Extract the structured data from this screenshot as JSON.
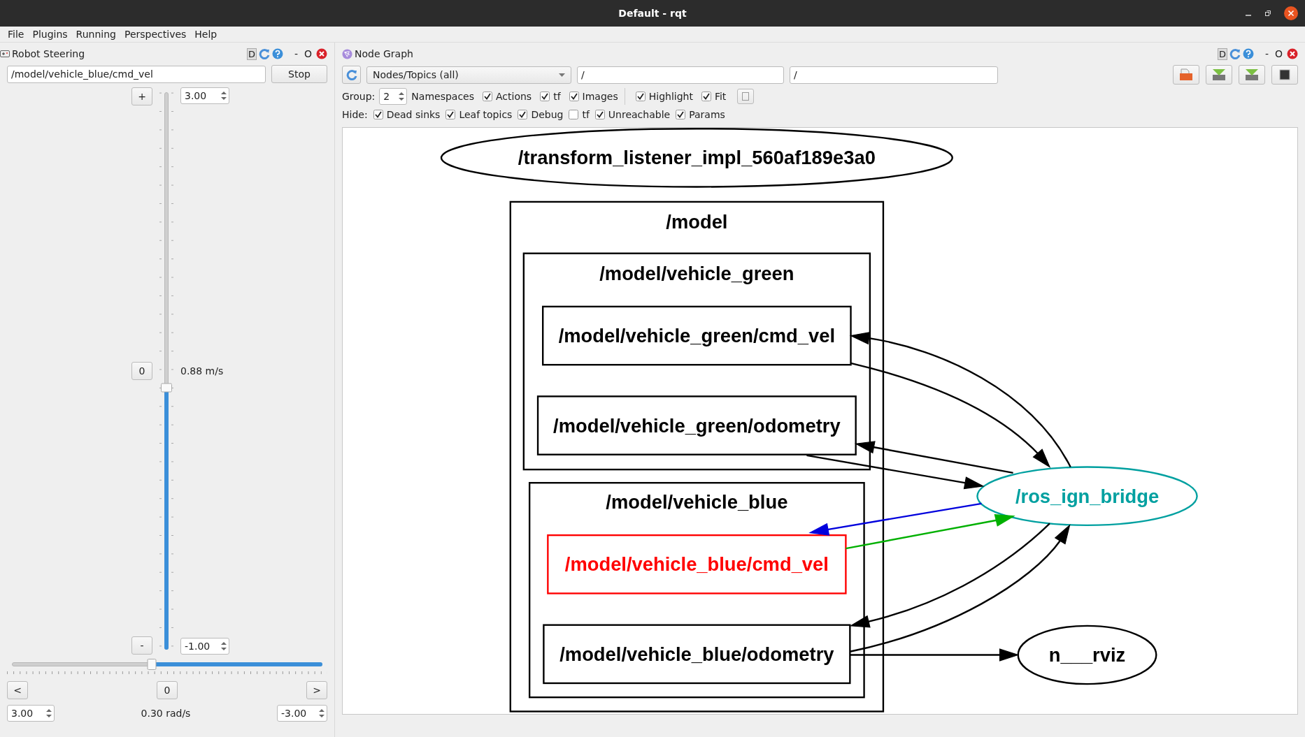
{
  "window": {
    "title": "Default - rqt"
  },
  "menu": [
    "File",
    "Plugins",
    "Running",
    "Perspectives",
    "Help"
  ],
  "robot_steering": {
    "title": "Robot Steering",
    "dock_buttons": [
      "D",
      "-",
      "O"
    ],
    "topic": "/model/vehicle_blue/cmd_vel",
    "stop_button": "Stop",
    "linear": {
      "increase": "+",
      "reset": "0",
      "decrease": "-",
      "max": "3.00",
      "min": "-1.00",
      "reading": "0.88 m/s",
      "level": 0.47
    },
    "angular": {
      "left": "<",
      "reset": "0",
      "right": ">",
      "max": "3.00",
      "min": "-3.00",
      "reading": "0.30 rad/s",
      "level": 0.55
    }
  },
  "node_graph": {
    "title": "Node Graph",
    "dock_buttons": [
      "D",
      "-",
      "O"
    ],
    "mode": "Nodes/Topics (all)",
    "node_filter": "/",
    "topic_filter": "/",
    "group_label": "Group:",
    "group": "2",
    "namespaces_label": "Namespaces",
    "options": [
      {
        "label": "Actions",
        "checked": true
      },
      {
        "label": "tf",
        "checked": true
      },
      {
        "label": "Images",
        "checked": true
      },
      {
        "label": "Highlight",
        "checked": true
      },
      {
        "label": "Fit",
        "checked": true
      }
    ],
    "hide_label": "Hide:",
    "hide": [
      {
        "label": "Dead sinks",
        "checked": true
      },
      {
        "label": "Leaf topics",
        "checked": true
      },
      {
        "label": "Debug",
        "checked": true
      },
      {
        "label": "tf",
        "checked": false
      },
      {
        "label": "Unreachable",
        "checked": true
      },
      {
        "label": "Params",
        "checked": true
      }
    ],
    "graph": {
      "nodes": [
        {
          "label": "/transform_listener_impl_560af189e3a0",
          "color": "#000000"
        },
        {
          "label": "/ros_ign_bridge",
          "color": "#00a0a0"
        },
        {
          "label": "n___rviz",
          "color": "#000000"
        }
      ],
      "cluster": {
        "label": "/model",
        "groups": [
          {
            "label": "/model/vehicle_green",
            "topics": [
              {
                "label": "/model/vehicle_green/cmd_vel",
                "color": "#000000"
              },
              {
                "label": "/model/vehicle_green/odometry",
                "color": "#000000"
              }
            ]
          },
          {
            "label": "/model/vehicle_blue",
            "topics": [
              {
                "label": "/model/vehicle_blue/cmd_vel",
                "color": "#ff0000"
              },
              {
                "label": "/model/vehicle_blue/odometry",
                "color": "#000000"
              }
            ]
          }
        ]
      }
    }
  }
}
